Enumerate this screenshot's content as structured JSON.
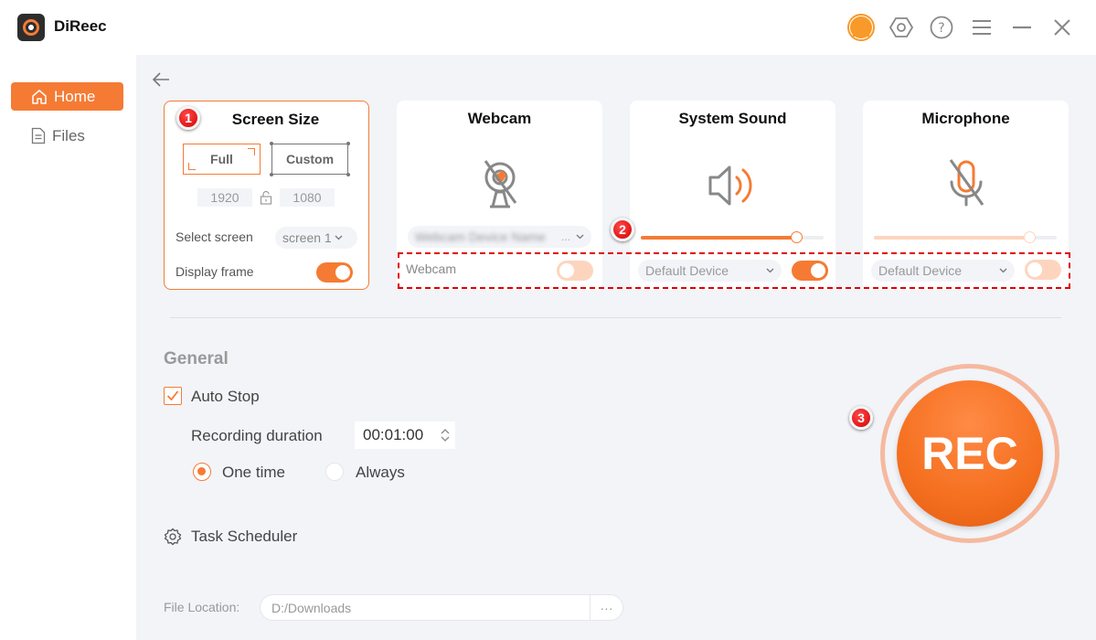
{
  "app": {
    "title": "DiReec"
  },
  "window_controls": [
    "account-icon",
    "settings-icon",
    "help-icon",
    "menu-icon",
    "minimize-icon",
    "close-icon"
  ],
  "sidebar": {
    "items": [
      {
        "label": "Home",
        "icon": "home-icon",
        "active": true
      },
      {
        "label": "Files",
        "icon": "file-icon",
        "active": false
      }
    ]
  },
  "cards": {
    "screen_size": {
      "title": "Screen Size",
      "badge": "1",
      "modes": {
        "full": "Full",
        "custom": "Custom",
        "selected": "Full"
      },
      "width": "1920",
      "height": "1080",
      "select_screen_label": "Select screen",
      "select_screen_value": "screen 1",
      "display_frame_label": "Display frame",
      "display_frame_on": true
    },
    "webcam": {
      "title": "Webcam",
      "device_value": "Webcam Device Name",
      "device_ellipsis": "...",
      "toggle_label": "Webcam",
      "toggle_on": false
    },
    "system_sound": {
      "title": "System Sound",
      "badge": "2",
      "volume_percent": 85,
      "device": "Default Device",
      "toggle_on": true
    },
    "microphone": {
      "title": "Microphone",
      "volume_percent": 85,
      "device": "Default Device",
      "toggle_on": false
    }
  },
  "general": {
    "title": "General",
    "auto_stop_label": "Auto Stop",
    "auto_stop_checked": true,
    "duration_label": "Recording duration",
    "duration_value": "00:01:00",
    "radio_options": [
      {
        "label": "One time",
        "selected": true
      },
      {
        "label": "Always",
        "selected": false
      }
    ],
    "task_scheduler_label": "Task Scheduler"
  },
  "rec": {
    "label": "REC",
    "badge": "3"
  },
  "file_location": {
    "label": "File Location:",
    "value": "D:/Downloads",
    "more_label": "···"
  },
  "colors": {
    "accent": "#f57b34",
    "accent_light": "#fdd5bf",
    "badge": "#e00000",
    "bg": "#f2f4f8"
  }
}
